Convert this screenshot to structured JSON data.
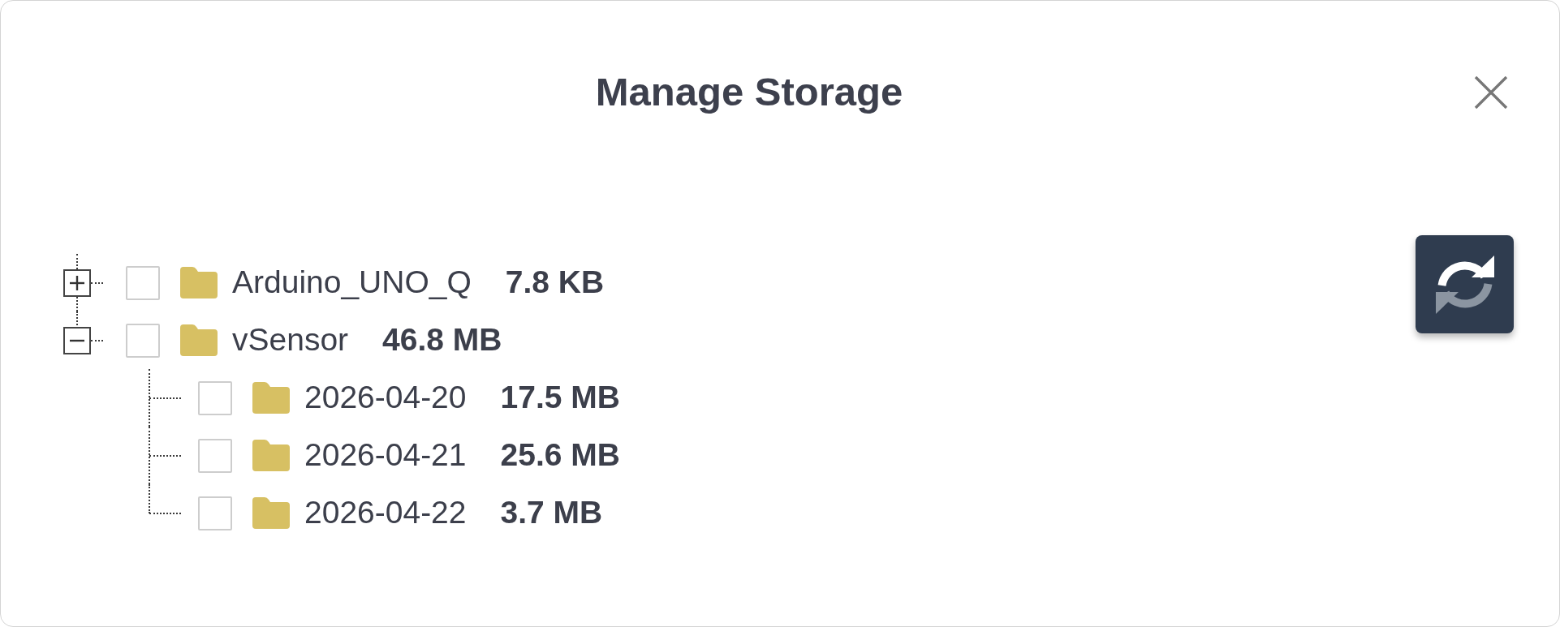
{
  "dialog": {
    "title": "Manage Storage"
  },
  "tree": [
    {
      "name": "Arduino_UNO_Q",
      "size": "7.8 KB",
      "checked": false,
      "expanded": false
    },
    {
      "name": "vSensor",
      "size": "46.8 MB",
      "checked": false,
      "expanded": true,
      "children": [
        {
          "name": "2026-04-20",
          "size": "17.5 MB",
          "checked": false
        },
        {
          "name": "2026-04-21",
          "size": "25.6 MB",
          "checked": false
        },
        {
          "name": "2026-04-22",
          "size": "3.7 MB",
          "checked": false
        }
      ]
    }
  ]
}
